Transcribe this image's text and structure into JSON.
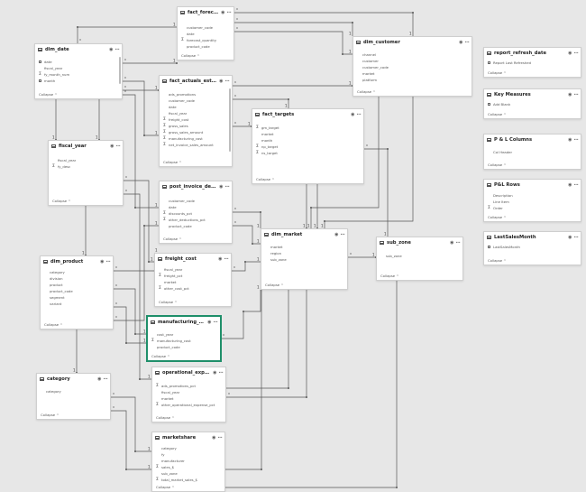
{
  "colors": {
    "background": "#e7e7e7",
    "line": "#555555",
    "selected_border": "#1f8f6a"
  },
  "collapse_label": "Collapse ^",
  "tables": {
    "fact_forecast_monthly": {
      "title": "fact_forecast_monthly",
      "fields": [
        {
          "icon": "",
          "name": "customer_code"
        },
        {
          "icon": "",
          "name": "date"
        },
        {
          "icon": "sum",
          "name": "forecast_quantity"
        },
        {
          "icon": "",
          "name": "product_code"
        }
      ]
    },
    "dim_date": {
      "title": "dim_date",
      "fields": [
        {
          "icon": "calendar",
          "name": "date"
        },
        {
          "icon": "",
          "name": "fiscal_year"
        },
        {
          "icon": "sum",
          "name": "fy_month_num"
        },
        {
          "icon": "calendar",
          "name": "month"
        }
      ]
    },
    "fact_actuals_estimates": {
      "title": "fact_actuals_estimates",
      "fields": [
        {
          "icon": "",
          "name": "ads_promotions"
        },
        {
          "icon": "",
          "name": "customer_code"
        },
        {
          "icon": "",
          "name": "date"
        },
        {
          "icon": "",
          "name": "fiscal_year"
        },
        {
          "icon": "sum",
          "name": "freight_cost"
        },
        {
          "icon": "sum",
          "name": "gross_sales"
        },
        {
          "icon": "sum",
          "name": "gross_sales_amount"
        },
        {
          "icon": "sum",
          "name": "manufacturing_cost"
        },
        {
          "icon": "sum",
          "name": "net_invoice_sales_amount"
        }
      ]
    },
    "dim_customer": {
      "title": "dim_customer",
      "fields": [
        {
          "icon": "",
          "name": "channel"
        },
        {
          "icon": "",
          "name": "customer"
        },
        {
          "icon": "",
          "name": "customer_code"
        },
        {
          "icon": "",
          "name": "market"
        },
        {
          "icon": "",
          "name": "platform"
        }
      ]
    },
    "report_refresh_date": {
      "title": "report_refresh_date",
      "fields": [
        {
          "icon": "calendar",
          "name": "Report Last Refreshed"
        }
      ]
    },
    "key_measures": {
      "title": "Key Measures",
      "fields": [
        {
          "icon": "calendar",
          "name": "Add Blank"
        }
      ]
    },
    "pl_columns": {
      "title": "P & L Columns",
      "fields": [
        {
          "icon": "",
          "name": "Col Header"
        }
      ]
    },
    "pl_rows": {
      "title": "P&L Rows",
      "fields": [
        {
          "icon": "",
          "name": "Description"
        },
        {
          "icon": "",
          "name": "Line Item"
        },
        {
          "icon": "sum",
          "name": "Order"
        }
      ]
    },
    "last_sales_month": {
      "title": "LastSalesMonth",
      "fields": [
        {
          "icon": "calendar",
          "name": "LastSalesMonth"
        }
      ]
    },
    "fiscal_year": {
      "title": "fiscal_year",
      "fields": [
        {
          "icon": "",
          "name": "fiscal_year"
        },
        {
          "icon": "sum",
          "name": "fy_desc"
        }
      ]
    },
    "fact_targets": {
      "title": "fact_targets",
      "fields": [
        {
          "icon": "sum",
          "name": "gm_target"
        },
        {
          "icon": "",
          "name": "market"
        },
        {
          "icon": "",
          "name": "month"
        },
        {
          "icon": "sum",
          "name": "np_target"
        },
        {
          "icon": "sum",
          "name": "ns_target"
        }
      ]
    },
    "post_invoice_deductions": {
      "title": "post_invoice_deducti...",
      "fields": [
        {
          "icon": "",
          "name": "customer_code"
        },
        {
          "icon": "",
          "name": "date"
        },
        {
          "icon": "sum",
          "name": "discounts_pct"
        },
        {
          "icon": "sum",
          "name": "other_deductions_pct"
        },
        {
          "icon": "",
          "name": "product_code"
        }
      ]
    },
    "dim_market": {
      "title": "dim_market",
      "fields": [
        {
          "icon": "",
          "name": "market"
        },
        {
          "icon": "",
          "name": "region"
        },
        {
          "icon": "",
          "name": "sub_zone"
        }
      ]
    },
    "sub_zone": {
      "title": "sub_zone",
      "fields": [
        {
          "icon": "",
          "name": "sub_zone"
        }
      ]
    },
    "dim_product": {
      "title": "dim_product",
      "fields": [
        {
          "icon": "",
          "name": "category"
        },
        {
          "icon": "",
          "name": "division"
        },
        {
          "icon": "",
          "name": "product"
        },
        {
          "icon": "",
          "name": "product_code"
        },
        {
          "icon": "",
          "name": "segment"
        },
        {
          "icon": "",
          "name": "variant"
        }
      ]
    },
    "freight_cost": {
      "title": "freight_cost",
      "fields": [
        {
          "icon": "",
          "name": "fiscal_year"
        },
        {
          "icon": "sum",
          "name": "freight_pct"
        },
        {
          "icon": "",
          "name": "market"
        },
        {
          "icon": "sum",
          "name": "other_cost_pct"
        }
      ]
    },
    "manufacturing_cost": {
      "title": "manufacturing_cost",
      "fields": [
        {
          "icon": "",
          "name": "cost_year"
        },
        {
          "icon": "sum",
          "name": "manufacturing_cost"
        },
        {
          "icon": "",
          "name": "product_code"
        }
      ]
    },
    "category": {
      "title": "category",
      "fields": [
        {
          "icon": "",
          "name": "category"
        }
      ]
    },
    "operational_expense": {
      "title": "operational_expense",
      "fields": [
        {
          "icon": "sum",
          "name": "ads_promotions_pct"
        },
        {
          "icon": "",
          "name": "fiscal_year"
        },
        {
          "icon": "",
          "name": "market"
        },
        {
          "icon": "sum",
          "name": "other_operational_expense_pct"
        }
      ]
    },
    "marketshare": {
      "title": "marketshare",
      "fields": [
        {
          "icon": "",
          "name": "category"
        },
        {
          "icon": "",
          "name": "fy"
        },
        {
          "icon": "",
          "name": "manufacturer"
        },
        {
          "icon": "sum",
          "name": "sales_$"
        },
        {
          "icon": "",
          "name": "sub_zone"
        },
        {
          "icon": "sum",
          "name": "total_market_sales_$"
        }
      ]
    }
  },
  "relationship_labels": {
    "one": "1",
    "many": "*"
  }
}
